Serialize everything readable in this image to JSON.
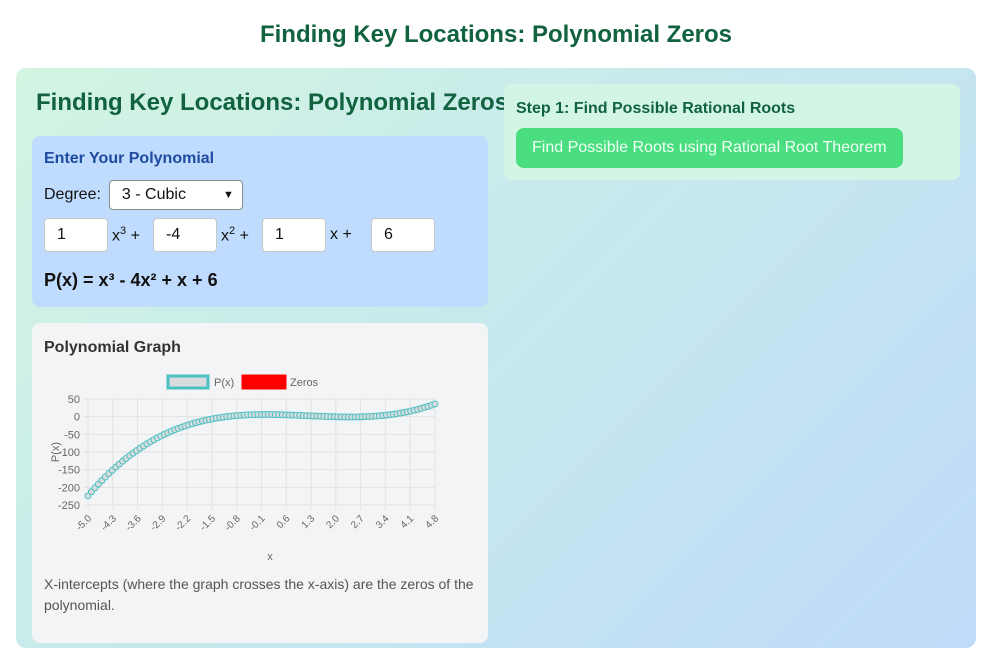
{
  "page": {
    "title": "Finding Key Locations: Polynomial Zeros"
  },
  "panel": {
    "heading": "Finding Key Locations: Polynomial Zeros"
  },
  "polynomial_input": {
    "title": "Enter Your Polynomial",
    "degree_label": "Degree:",
    "degree_selected": "3 - Cubic",
    "coefficients": [
      {
        "value": "1",
        "term_base": "x",
        "term_exp": "3",
        "term_suffix": "+"
      },
      {
        "value": "-4",
        "term_base": "x",
        "term_exp": "2",
        "term_suffix": "+"
      },
      {
        "value": "1",
        "term_base": "x",
        "term_exp": "",
        "term_suffix": "+"
      },
      {
        "value": "6",
        "term_base": "",
        "term_exp": "",
        "term_suffix": ""
      }
    ],
    "expression": "P(x) = x³ - 4x² + x + 6"
  },
  "graph": {
    "title": "Polynomial Graph",
    "note": "X-intercepts (where the graph crosses the x-axis) are the zeros of the polynomial."
  },
  "step1": {
    "title": "Step 1: Find Possible Rational Roots",
    "button_label": "Find Possible Roots using Rational Root Theorem"
  },
  "chart_data": {
    "type": "line",
    "xlabel": "x",
    "ylabel": "P(x)",
    "x_tick_labels": [
      "-5.0",
      "-4.3",
      "-3.6",
      "-2.9",
      "-2.2",
      "-1.5",
      "-0.8",
      "-0.1",
      "0.6",
      "1.3",
      "2.0",
      "2.7",
      "3.4",
      "4.1",
      "4.8"
    ],
    "ylim": [
      -250,
      50
    ],
    "y_ticks": [
      50,
      0,
      -50,
      -100,
      -150,
      -200,
      -250
    ],
    "x_range": [
      -5.0,
      5.0
    ],
    "x_step": 0.1,
    "coefficients": [
      1,
      -4,
      1,
      6
    ],
    "grid": true,
    "legend_position": "top",
    "series": [
      {
        "name": "P(x)",
        "color": "#4bc0c0",
        "fill": "#d9dcde"
      },
      {
        "name": "Zeros",
        "color": "#ff0000",
        "fill": "#ff0000"
      }
    ]
  }
}
